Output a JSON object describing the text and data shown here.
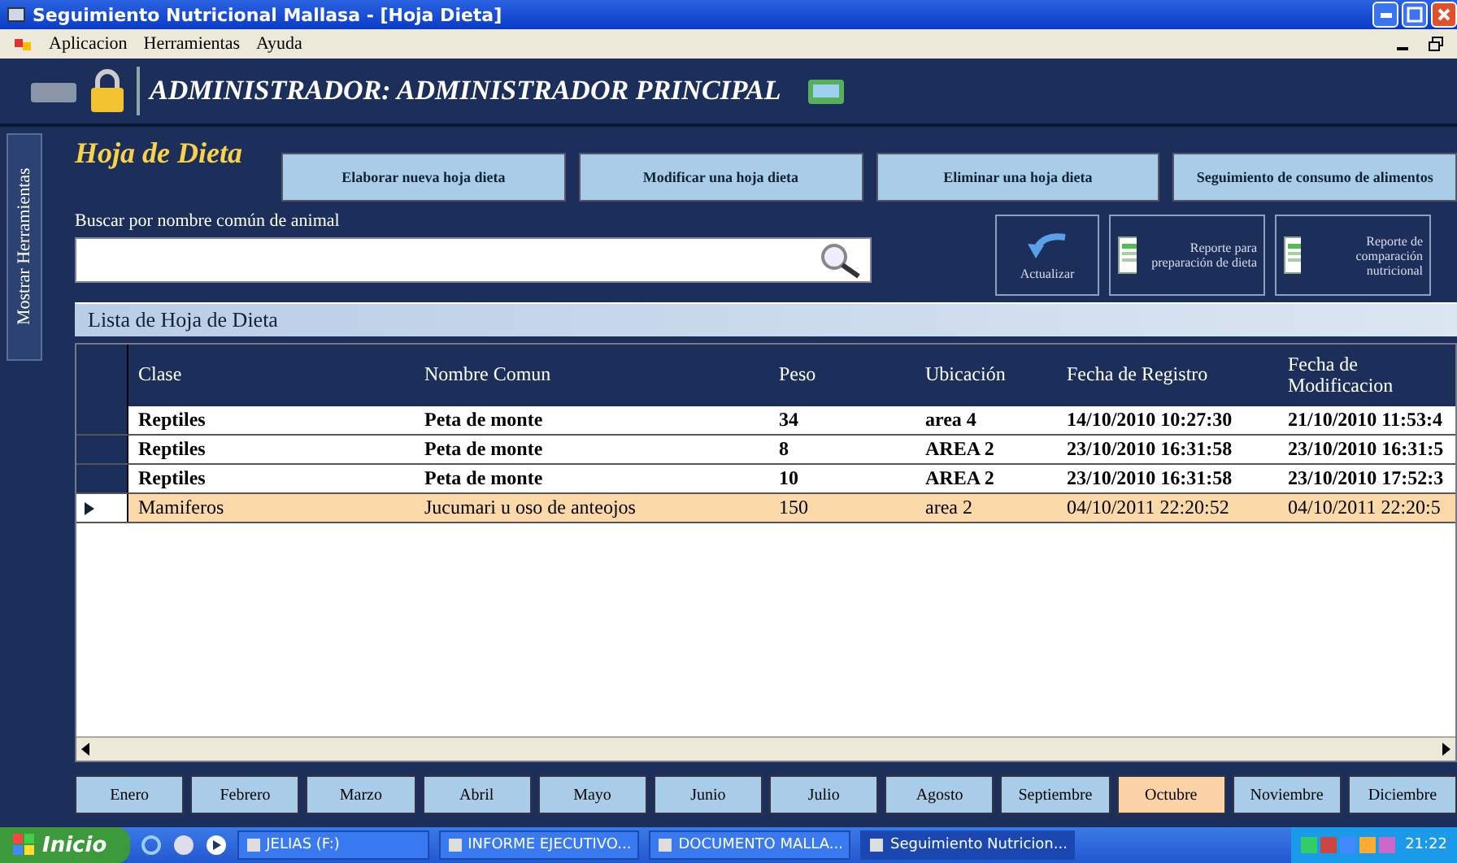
{
  "window": {
    "title": "Seguimiento Nutricional Mallasa - [Hoja Dieta]"
  },
  "menu": [
    "Aplicacion",
    "Herramientas",
    "Ayuda"
  ],
  "header": {
    "user": "ADMINISTRADOR: ADMINISTRADOR PRINCIPAL"
  },
  "sidebar": {
    "label": "Mostrar Herramientas"
  },
  "page": {
    "title": "Hoja de Dieta",
    "actions": [
      "Elaborar nueva hoja dieta",
      "Modificar una hoja dieta",
      "Eliminar una hoja dieta",
      "Seguimiento de consumo de alimentos"
    ]
  },
  "search": {
    "label": "Buscar por nombre común de animal"
  },
  "tools": [
    {
      "kind": "refresh",
      "label": "Actualizar"
    },
    {
      "kind": "report",
      "label": "Reporte para preparación de dieta"
    },
    {
      "kind": "report",
      "label": "Reporte de comparación nutricional"
    }
  ],
  "list": {
    "title": "Lista de Hoja de Dieta",
    "columns": [
      "Clase",
      "Nombre Comun",
      "Peso",
      "Ubicación",
      "Fecha de Registro",
      "Fecha de Modificacion"
    ],
    "rows": [
      {
        "selected": false,
        "cells": [
          "Reptiles",
          "Peta de monte",
          "34",
          "area 4",
          "14/10/2010 10:27:30",
          "21/10/2010 11:53:4"
        ]
      },
      {
        "selected": false,
        "cells": [
          "Reptiles",
          "Peta de monte",
          "8",
          "AREA 2",
          "23/10/2010 16:31:58",
          "23/10/2010 16:31:5"
        ]
      },
      {
        "selected": false,
        "cells": [
          "Reptiles",
          "Peta de monte",
          "10",
          "AREA 2",
          "23/10/2010 16:31:58",
          "23/10/2010 17:52:3"
        ]
      },
      {
        "selected": true,
        "cells": [
          "Mamiferos",
          "Jucumari u oso de anteojos",
          "150",
          "area 2",
          "04/10/2011 22:20:52",
          "04/10/2011 22:20:5"
        ]
      }
    ]
  },
  "months": [
    {
      "label": "Enero",
      "selected": false
    },
    {
      "label": "Febrero",
      "selected": false
    },
    {
      "label": "Marzo",
      "selected": false
    },
    {
      "label": "Abril",
      "selected": false
    },
    {
      "label": "Mayo",
      "selected": false
    },
    {
      "label": "Junio",
      "selected": false
    },
    {
      "label": "Julio",
      "selected": false
    },
    {
      "label": "Agosto",
      "selected": false
    },
    {
      "label": "Septiembre",
      "selected": false
    },
    {
      "label": "Octubre",
      "selected": true
    },
    {
      "label": "Noviembre",
      "selected": false
    },
    {
      "label": "Diciembre",
      "selected": false
    }
  ],
  "taskbar": {
    "start": "Inicio",
    "tasks": [
      {
        "label": "JELIAS (F:)",
        "selected": false
      },
      {
        "label": "INFORME EJECUTIVO...",
        "selected": false
      },
      {
        "label": "DOCUMENTO MALLA...",
        "selected": false
      },
      {
        "label": "Seguimiento Nutricion...",
        "selected": true
      }
    ],
    "clock": "21:22"
  }
}
